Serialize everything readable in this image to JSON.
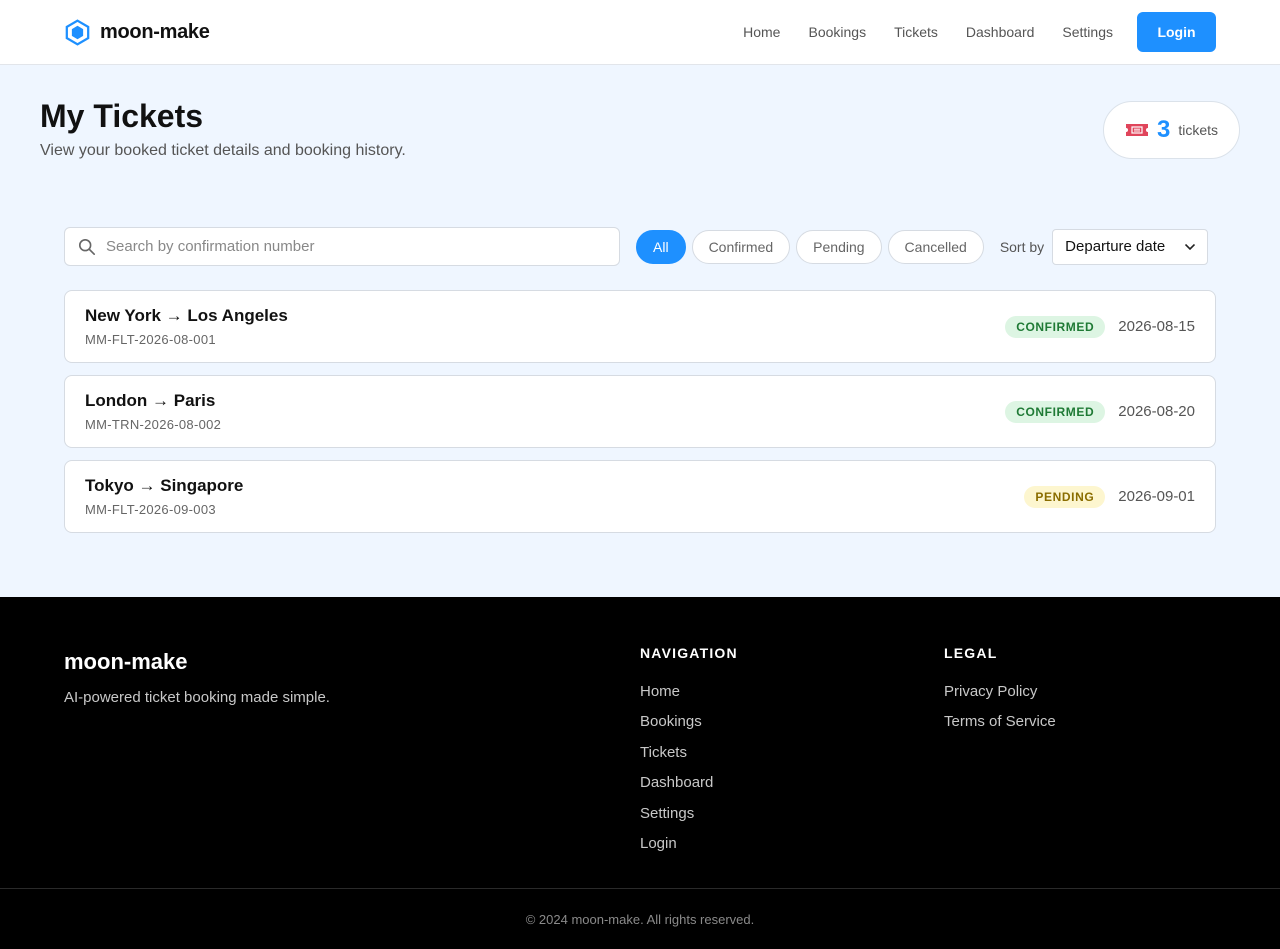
{
  "header": {
    "brand": "moon-make",
    "nav": [
      "Home",
      "Bookings",
      "Tickets",
      "Dashboard",
      "Settings"
    ],
    "login_label": "Login"
  },
  "page": {
    "title": "My Tickets",
    "subtitle": "View your booked ticket details and booking history.",
    "ticket_count": "3",
    "ticket_count_label": "tickets"
  },
  "filters": {
    "search_placeholder": "Search by confirmation number",
    "search_value": "",
    "chips": [
      "All",
      "Confirmed",
      "Pending",
      "Cancelled"
    ],
    "active_chip": "All",
    "sort_label": "Sort by",
    "sort_value": "Departure date"
  },
  "tickets": [
    {
      "route": "New York → Los Angeles",
      "confirmation": "MM-FLT-2026-08-001",
      "status": "CONFIRMED",
      "status_kind": "confirmed",
      "date": "2026-08-15"
    },
    {
      "route": "London → Paris",
      "confirmation": "MM-TRN-2026-08-002",
      "status": "CONFIRMED",
      "status_kind": "confirmed",
      "date": "2026-08-20"
    },
    {
      "route": "Tokyo → Singapore",
      "confirmation": "MM-FLT-2026-09-003",
      "status": "PENDING",
      "status_kind": "pending",
      "date": "2026-09-01"
    }
  ],
  "footer": {
    "brand": "moon-make",
    "tagline": "AI-powered ticket booking made simple.",
    "nav_heading": "NAVIGATION",
    "nav_links": [
      "Home",
      "Bookings",
      "Tickets",
      "Dashboard",
      "Settings",
      "Login"
    ],
    "legal_heading": "LEGAL",
    "legal_links": [
      "Privacy Policy",
      "Terms of Service"
    ],
    "copyright": "© 2024 moon-make. All rights reserved."
  },
  "colors": {
    "accent": "#1e90ff",
    "page_background": "#eff6ff",
    "confirmed_badge": "#ddf5e3",
    "pending_badge": "#fdf6cf",
    "footer_background": "#000000"
  },
  "icons": {
    "brand": "hexagon-logo-icon",
    "count": "ticket-icon",
    "search": "search-icon",
    "sort": "chevron-down-icon"
  }
}
